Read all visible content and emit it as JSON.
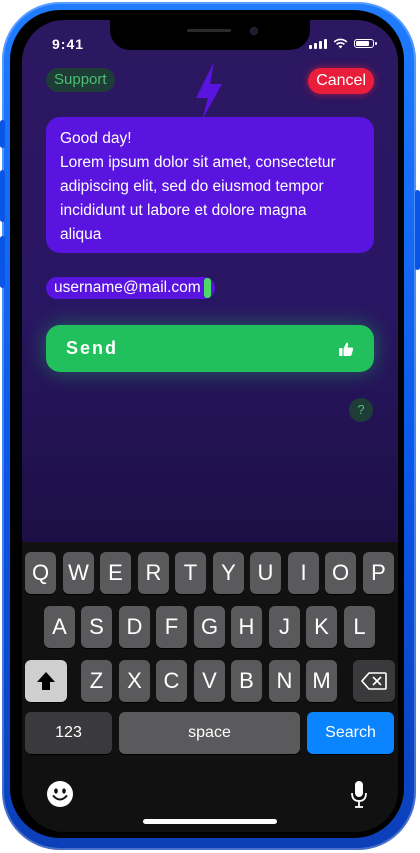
{
  "status_bar": {
    "time": "9:41",
    "battery_level": 0.85
  },
  "header": {
    "support_label": "Support",
    "cancel_label": "Cancel",
    "logo_icon": "lightning-bolt-icon"
  },
  "message": {
    "lines": [
      "Good day!",
      "Lorem ipsum dolor sit amet, consectetur",
      "adipiscing elit, sed do eiusmod tempor",
      "incididunt ut labore et dolore magna",
      "aliqua"
    ]
  },
  "email": {
    "value": "username@mail.com"
  },
  "send": {
    "label": "Send",
    "icon": "thumbs-up-icon"
  },
  "help": {
    "label": "?"
  },
  "keyboard": {
    "row1": [
      "Q",
      "W",
      "E",
      "R",
      "T",
      "Y",
      "U",
      "I",
      "O",
      "P"
    ],
    "row2": [
      "A",
      "S",
      "D",
      "F",
      "G",
      "H",
      "J",
      "K",
      "L"
    ],
    "row3": [
      "Z",
      "X",
      "C",
      "V",
      "B",
      "N",
      "M"
    ],
    "numbers_label": "123",
    "space_label": "space",
    "search_label": "Search"
  },
  "colors": {
    "accent": "#5a14e0",
    "send": "#21c05c",
    "cancel": "#e81e3a",
    "search_key": "#0a84ff"
  }
}
